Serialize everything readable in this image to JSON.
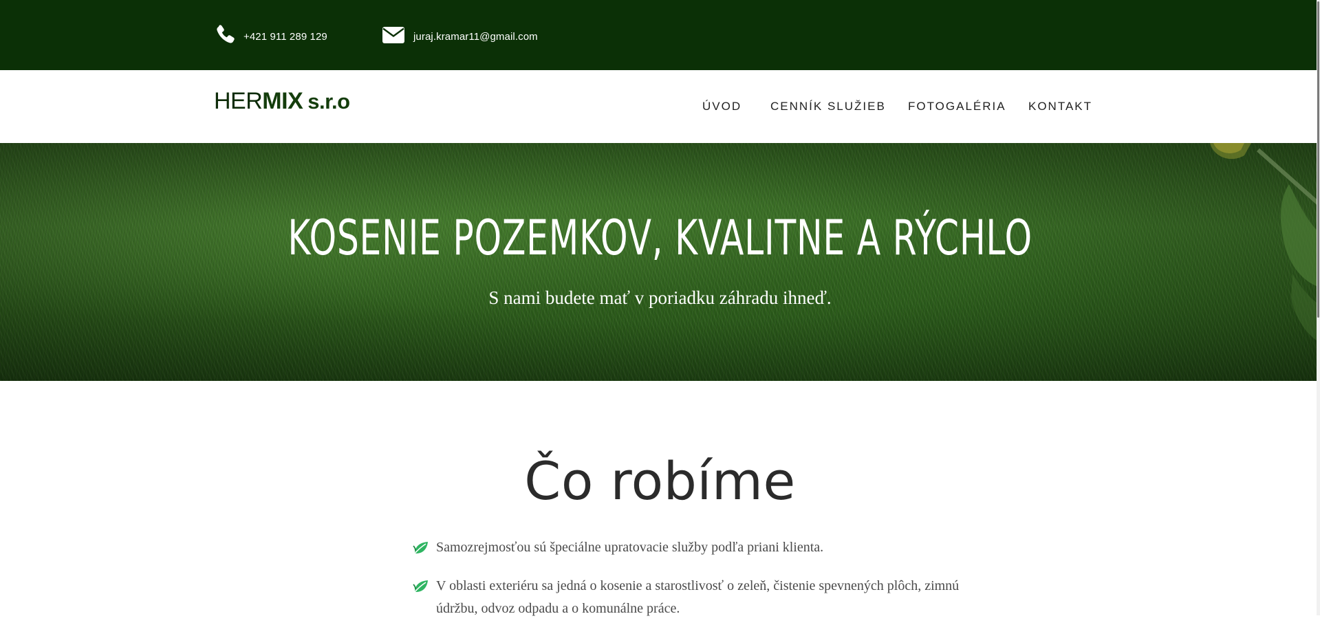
{
  "topbar": {
    "phone": {
      "icon": "phone-icon",
      "text": "+421 911 289 129"
    },
    "email": {
      "icon": "envelope-icon",
      "text": "juraj.kramar11@gmail.com"
    },
    "background": "#0b3006"
  },
  "header": {
    "logo": {
      "part1": "HER",
      "part2": "MIX",
      "suffix": "s.r.o"
    },
    "nav": [
      {
        "label": "ÚVOD"
      },
      {
        "label": "CENNÍK SLUŽIEB"
      },
      {
        "label": "FOTOGALÉRIA"
      },
      {
        "label": "KONTAKT"
      }
    ]
  },
  "hero": {
    "title": "KOSENIE POZEMKOV, KVALITNE A RÝCHLO",
    "subtitle": "S nami budete mať v poriadku záhradu ihneď."
  },
  "services": {
    "title": "Čo robíme",
    "items": [
      {
        "icon": "leaf-icon",
        "text": "Samozrejmosťou sú špeciálne upratovacie služby podľa priani klienta."
      },
      {
        "icon": "leaf-icon",
        "text": "V oblasti exteriéru sa jedná o kosenie a starostlivosť o zeleň, čistenie spevnených plôch, zimnú údržbu, odvoz odpadu a o komunálne práce."
      }
    ]
  },
  "colors": {
    "brand_dark_green": "#0b3006",
    "leaf_green": "#2fb562"
  }
}
